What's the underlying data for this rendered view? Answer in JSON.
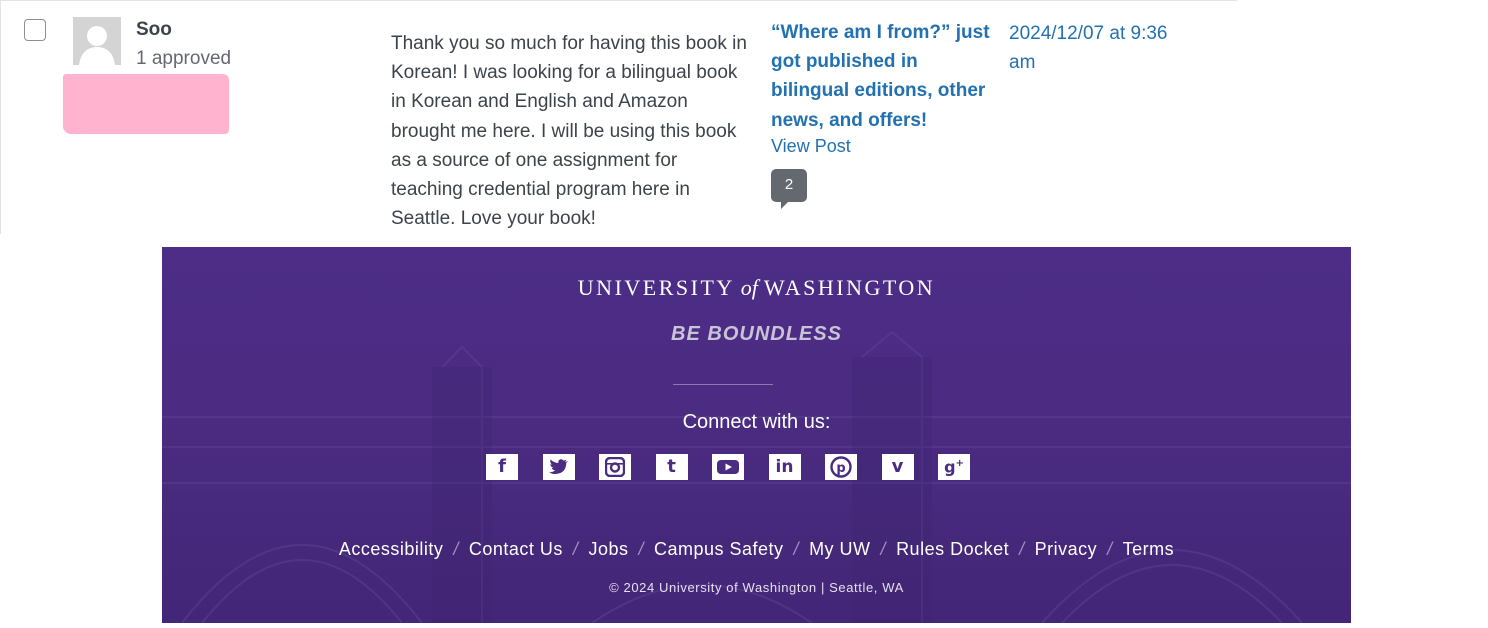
{
  "comment": {
    "author_name": "Soo",
    "author_status": "1 approved",
    "text": "Thank you so much for having this book in Korean! I was looking for a bilingual book in Korean and English and Amazon brought me here. I will be using this book as a source of one assignment for teaching credential program here in Seattle. Love your book!",
    "post_title": "“Where am I from?” just got published in bilingual editions, other news, and offers!",
    "view_post": "View Post",
    "comment_count": "2",
    "date": "2024/12/07 at 9:36 am"
  },
  "footer": {
    "university": "UNIVERSITY",
    "of": "of",
    "washington": "WASHINGTON",
    "tagline": "BE BOUNDLESS",
    "connect": "Connect with us:",
    "social_icons": [
      "facebook-icon",
      "twitter-icon",
      "instagram-icon",
      "tumblr-icon",
      "youtube-icon",
      "linkedin-icon",
      "pinterest-icon",
      "vine-icon",
      "google-plus-icon"
    ],
    "links": [
      "Accessibility",
      "Contact Us",
      "Jobs",
      "Campus Safety",
      "My UW",
      "Rules Docket",
      "Privacy",
      "Terms"
    ],
    "copyright": "© 2024 University of Washington | Seattle, WA",
    "colors": {
      "background": "#4b2c82",
      "link": "#2271b1"
    }
  }
}
